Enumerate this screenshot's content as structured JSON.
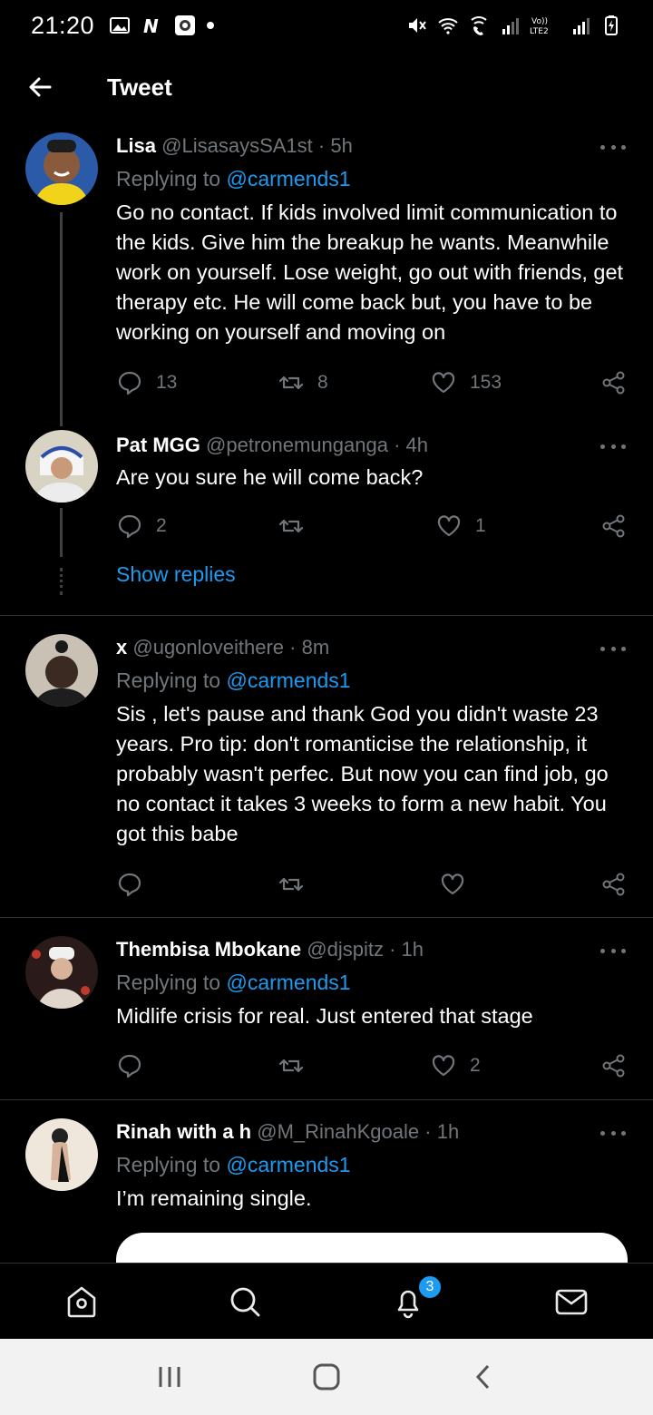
{
  "status_bar": {
    "time": "21:20",
    "icons": [
      "gallery-icon",
      "netflix-icon",
      "app-icon",
      "mute-icon",
      "wifi-icon",
      "wifi-calling-icon",
      "signal-icon",
      "volte-lte2-icon",
      "battery-charging-icon"
    ],
    "lte_label": "Vo))\nLTE2"
  },
  "header": {
    "title": "Tweet"
  },
  "tweets": [
    {
      "name": "Lisa",
      "handle": "@LisasaysSA1st",
      "time": "· 5h",
      "replying_label": "Replying to ",
      "replying_to": "@carmends1",
      "text": "Go no contact. If kids involved limit communication to the kids. Give him the breakup he wants. Meanwhile work on yourself. Lose weight, go out with friends, get therapy etc. He will come back but, you have to be working on yourself and moving on",
      "replies": "13",
      "retweets": "8",
      "likes": "153"
    },
    {
      "name": "Pat MGG",
      "handle": "@petronemunganga",
      "time": "· 4h",
      "text": "Are you sure he will come back?",
      "replies": "2",
      "retweets": "",
      "likes": "1"
    },
    {
      "name": "x",
      "handle": "@ugonloveithere",
      "time": "· 8m",
      "replying_label": "Replying to ",
      "replying_to": "@carmends1",
      "text": "Sis , let's pause and thank God you didn't waste 23 years. Pro tip: don't romanticise the relationship, it probably wasn't perfec. But now you can find job, go no contact it takes 3 weeks to form a new habit. You got this babe",
      "replies": "",
      "retweets": "",
      "likes": ""
    },
    {
      "name": "Thembisa Mbokane",
      "handle": "@djspitz",
      "time": "· 1h",
      "replying_label": "Replying to ",
      "replying_to": "@carmends1",
      "text": "Midlife crisis for real. Just entered that stage",
      "replies": "",
      "retweets": "",
      "likes": "2"
    },
    {
      "name": "Rinah with a h",
      "handle": "@M_RinahKgoale",
      "time": "· 1h",
      "replying_label": "Replying to ",
      "replying_to": "@carmends1",
      "text": "I’m remaining single."
    }
  ],
  "show_replies": "Show replies",
  "bottom_nav": {
    "items": [
      "home-icon",
      "search-icon",
      "notifications-icon",
      "messages-icon"
    ],
    "notification_count": "3"
  },
  "colors": {
    "accent": "#1d9bf0",
    "background": "#000000",
    "muted": "#71767b"
  }
}
